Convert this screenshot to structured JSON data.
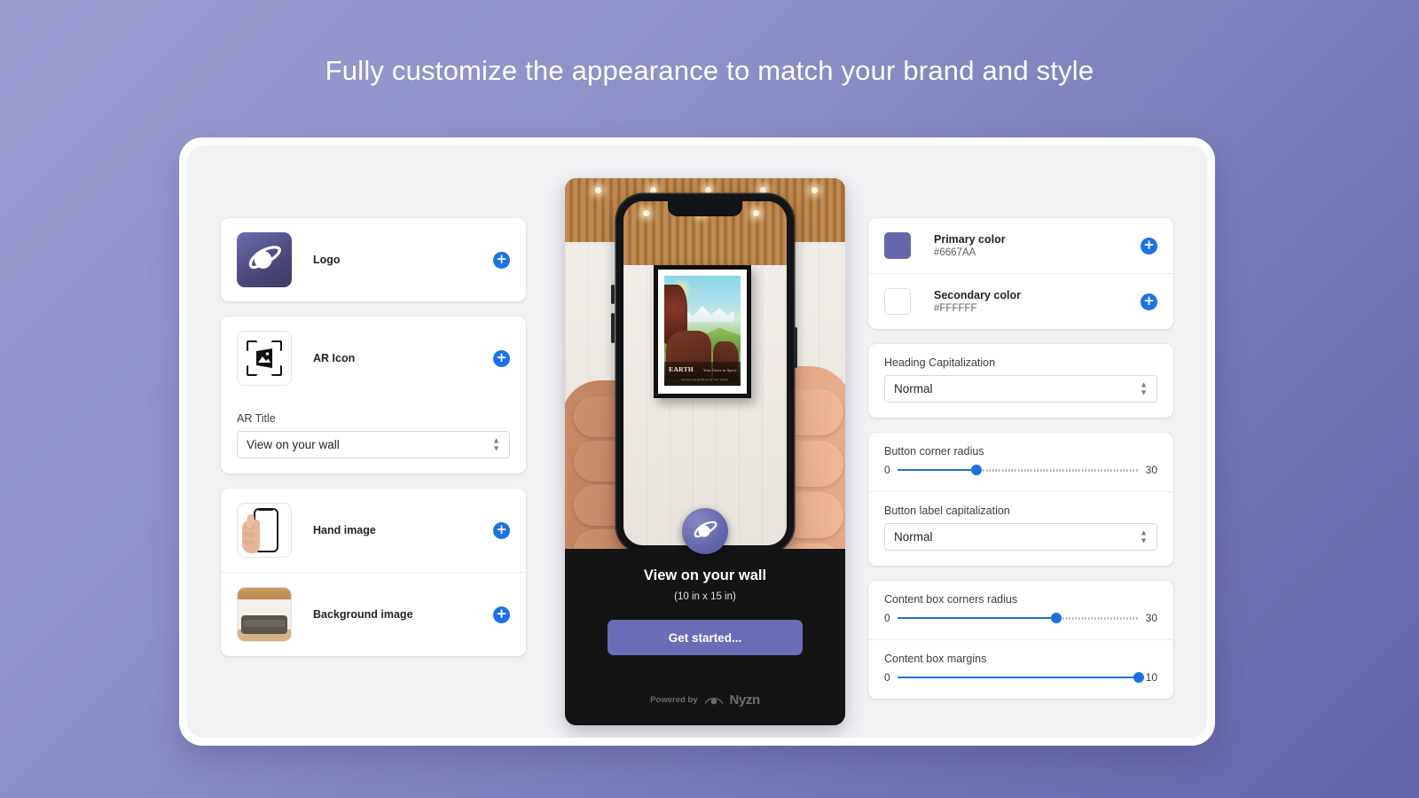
{
  "headline": "Fully customize the appearance to match your brand and style",
  "colors": {
    "primary": "#6667AA",
    "secondary": "#FFFFFF",
    "accent_blue": "#1B72E8",
    "bg_gradient_start": "#9A9CD2",
    "bg_gradient_end": "#6465AB"
  },
  "left_panel": {
    "logo_card": {
      "label": "Logo",
      "icon": "planet-icon",
      "add_label": "+"
    },
    "ar_icon_card": {
      "label": "AR Icon",
      "icon": "ar-scan-image-icon",
      "add_label": "+",
      "ar_title_field": {
        "label": "AR Title",
        "value": "View on your wall",
        "placeholder": "View on your wall"
      }
    },
    "images_card": {
      "rows": [
        {
          "label": "Hand image",
          "icon": "hand-phone-thumbnail",
          "add_label": "+"
        },
        {
          "label": "Background image",
          "icon": "room-sofa-thumbnail",
          "add_label": "+"
        }
      ]
    }
  },
  "right_panel": {
    "colors_card": {
      "rows": [
        {
          "name": "Primary color",
          "hex": "#6667AA",
          "swatch": "#6667AA",
          "add_label": "+"
        },
        {
          "name": "Secondary color",
          "hex": "#FFFFFF",
          "swatch": "#FFFFFF",
          "add_label": "+"
        }
      ]
    },
    "heading_card": {
      "label": "Heading Capitalization",
      "value": "Normal"
    },
    "button_card": {
      "corner_radius": {
        "label": "Button corner radius",
        "min": "0",
        "max": "30",
        "value": 10,
        "percent": 33
      },
      "label_capitalization": {
        "label": "Button label capitalization",
        "value": "Normal"
      }
    },
    "content_box_card": {
      "corners_radius": {
        "label": "Content box corners radius",
        "min": "0",
        "max": "30",
        "value": 20,
        "percent": 66
      },
      "margins": {
        "label": "Content box margins",
        "min": "0",
        "max": "10",
        "value": 10,
        "percent": 100
      }
    }
  },
  "phone_preview": {
    "ar_button_icon": "planet-icon",
    "title": "View on your wall",
    "dimensions": "(10 in x 15 in)",
    "cta_label": "Get started...",
    "powered_by_prefix": "Powered by",
    "powered_by_brand": "Nyzn",
    "poster": {
      "title": "EARTH",
      "subtitle": "Your Oasis in Space",
      "fine_print": "Visit the new worlds of our solar system"
    }
  }
}
